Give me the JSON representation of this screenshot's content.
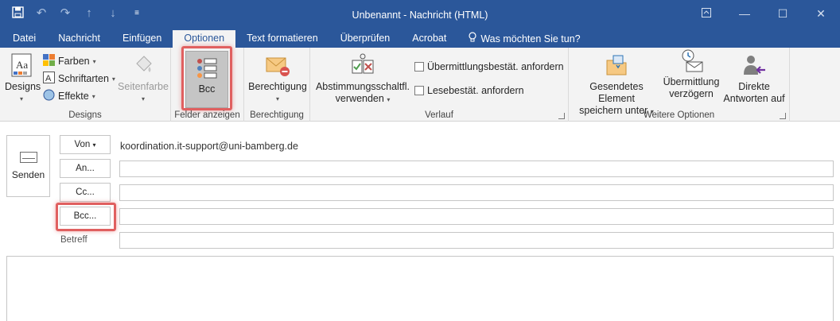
{
  "window": {
    "title": "Unbenannt - Nachricht (HTML)",
    "qat": [
      "save-icon",
      "undo-icon",
      "redo-icon",
      "up-arrow-icon",
      "down-arrow-icon",
      "customize-icon"
    ],
    "controls": [
      "ribbon-display-icon",
      "minimize-icon",
      "maximize-icon",
      "close-icon"
    ]
  },
  "tabs": [
    {
      "label": "Datei"
    },
    {
      "label": "Nachricht"
    },
    {
      "label": "Einfügen"
    },
    {
      "label": "Optionen",
      "active": true
    },
    {
      "label": "Text formatieren"
    },
    {
      "label": "Überprüfen"
    },
    {
      "label": "Acrobat"
    },
    {
      "label": "Was möchten Sie tun?",
      "icon": "lightbulb-icon"
    }
  ],
  "ribbon": {
    "designs": {
      "designs_label": "Designs",
      "farben_label": "Farben",
      "schriftarten_label": "Schriftarten",
      "effekte_label": "Effekte",
      "seitenfarbe_label": "Seitenfarbe",
      "group_label": "Designs"
    },
    "felder": {
      "bcc_label": "Bcc",
      "group_label": "Felder anzeigen"
    },
    "berechtigung": {
      "button_label": "Berechtigung",
      "group_label": "Berechtigung"
    },
    "verlauf": {
      "abstimmung_line1": "Abstimmungsschaltfl.",
      "abstimmung_line2": "verwenden",
      "uebermittlung_label": "Übermittlungsbestät. anfordern",
      "lesebestaet_label": "Lesebestät. anfordern",
      "group_label": "Verlauf"
    },
    "weitere": {
      "gesendetes_line1": "Gesendetes Element",
      "gesendetes_line2": "speichern unter",
      "verzoegern_line1": "Übermittlung",
      "verzoegern_line2": "verzögern",
      "antworten_line1": "Direkte",
      "antworten_line2": "Antworten auf",
      "group_label": "Weitere Optionen"
    }
  },
  "compose": {
    "send_label": "Senden",
    "from_label": "Von",
    "from_address": "koordination.it-support@uni-bamberg.de",
    "to_label": "An...",
    "cc_label": "Cc...",
    "bcc_label": "Bcc...",
    "subject_label": "Betreff"
  },
  "colors": {
    "brand": "#2b579a",
    "highlight": "#e06060",
    "ribbon_bg": "#f3f3f3"
  }
}
